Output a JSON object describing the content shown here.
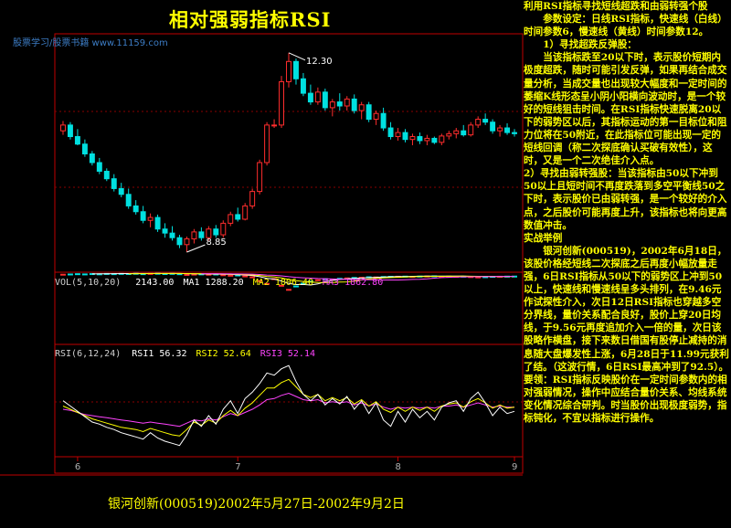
{
  "title": "相对强弱指标RSI",
  "watermark": "股票学习/股票书籍 www.11159.com",
  "caption": "银河创新(000519)2002年5月27日-2002年9月2日",
  "colors": {
    "up": "#ff2d2d",
    "down": "#00e0e0",
    "text": "#ffff00",
    "border": "#c00000",
    "ma1": "#ffffff",
    "ma2": "#ffff00",
    "ma3": "#ff44ff"
  },
  "volume_indicator": {
    "label": "VOL(5,10,20)",
    "value": "2143.00",
    "ma1": "MA1 1288.20",
    "ma2": "MA2 1806.40",
    "ma3": "MA3 1862.80"
  },
  "rsi_indicator": {
    "label": "RSI(6,12,24)",
    "rsi1": "RSI1 56.32",
    "rsi2": "RSI2 52.64",
    "rsi3": "RSI3 52.14"
  },
  "chart_data": {
    "type": "candlestick",
    "annotations": {
      "high": "12.30",
      "low": "8.85"
    },
    "x_ticks": [
      "6",
      "7",
      "8",
      "9"
    ],
    "ohlc": [
      [
        10.95,
        11.12,
        10.88,
        11.05
      ],
      [
        11.05,
        11.1,
        10.8,
        10.85
      ],
      [
        10.85,
        10.98,
        10.7,
        10.72
      ],
      [
        10.72,
        10.8,
        10.5,
        10.55
      ],
      [
        10.55,
        10.6,
        10.35,
        10.4
      ],
      [
        10.4,
        10.48,
        10.2,
        10.25
      ],
      [
        10.25,
        10.3,
        10.08,
        10.12
      ],
      [
        10.12,
        10.2,
        9.9,
        9.95
      ],
      [
        9.95,
        10.05,
        9.8,
        9.85
      ],
      [
        9.85,
        9.95,
        9.6,
        9.65
      ],
      [
        9.65,
        9.75,
        9.5,
        9.55
      ],
      [
        9.55,
        9.65,
        9.35,
        9.4
      ],
      [
        9.4,
        9.52,
        9.28,
        9.45
      ],
      [
        9.45,
        9.5,
        9.2,
        9.25
      ],
      [
        9.25,
        9.35,
        9.1,
        9.18
      ],
      [
        9.18,
        9.3,
        9.05,
        9.1
      ],
      [
        9.1,
        9.15,
        8.92,
        8.98
      ],
      [
        8.98,
        9.12,
        8.85,
        9.08
      ],
      [
        9.08,
        9.25,
        9.0,
        9.2
      ],
      [
        9.2,
        9.28,
        9.05,
        9.1
      ],
      [
        9.1,
        9.3,
        9.05,
        9.25
      ],
      [
        9.25,
        9.32,
        9.1,
        9.15
      ],
      [
        9.15,
        9.4,
        9.1,
        9.35
      ],
      [
        9.35,
        9.55,
        9.3,
        9.5
      ],
      [
        9.5,
        9.62,
        9.38,
        9.42
      ],
      [
        9.42,
        9.7,
        9.4,
        9.65
      ],
      [
        9.65,
        9.95,
        9.6,
        9.9
      ],
      [
        9.9,
        10.45,
        9.85,
        10.4
      ],
      [
        10.4,
        11.1,
        10.35,
        11.05
      ],
      [
        11.05,
        11.15,
        11.0,
        11.05
      ],
      [
        11.05,
        11.9,
        11.0,
        11.8
      ],
      [
        11.8,
        12.3,
        11.7,
        12.15
      ],
      [
        12.15,
        12.2,
        11.75,
        11.85
      ],
      [
        11.85,
        11.95,
        11.55,
        11.6
      ],
      [
        11.6,
        11.75,
        11.4,
        11.45
      ],
      [
        11.45,
        11.7,
        11.4,
        11.62
      ],
      [
        11.62,
        11.68,
        11.3,
        11.35
      ],
      [
        11.35,
        11.5,
        11.2,
        11.45
      ],
      [
        11.45,
        11.6,
        11.3,
        11.38
      ],
      [
        11.38,
        11.55,
        11.3,
        11.5
      ],
      [
        11.5,
        11.58,
        11.25,
        11.3
      ],
      [
        11.3,
        11.45,
        11.15,
        11.4
      ],
      [
        11.4,
        11.45,
        11.1,
        11.15
      ],
      [
        11.15,
        11.3,
        11.05,
        11.25
      ],
      [
        11.25,
        11.35,
        10.95,
        11.0
      ],
      [
        11.0,
        11.1,
        10.8,
        10.85
      ],
      [
        10.85,
        11.0,
        10.78,
        10.92
      ],
      [
        10.92,
        10.98,
        10.75,
        10.8
      ],
      [
        10.8,
        10.9,
        10.7,
        10.85
      ],
      [
        10.85,
        10.92,
        10.72,
        10.78
      ],
      [
        10.78,
        10.88,
        10.7,
        10.82
      ],
      [
        10.82,
        10.85,
        10.72,
        10.75
      ],
      [
        10.75,
        10.9,
        10.7,
        10.86
      ],
      [
        10.86,
        10.95,
        10.8,
        10.9
      ],
      [
        10.9,
        11.0,
        10.82,
        10.95
      ],
      [
        10.95,
        11.05,
        10.85,
        10.88
      ],
      [
        10.88,
        11.1,
        10.85,
        11.05
      ],
      [
        11.05,
        11.2,
        11.0,
        11.15
      ],
      [
        11.15,
        11.25,
        11.05,
        11.1
      ],
      [
        11.1,
        11.15,
        10.9,
        10.95
      ],
      [
        10.95,
        11.05,
        10.85,
        11.0
      ],
      [
        11.0,
        11.08,
        10.88,
        10.92
      ],
      [
        10.92,
        10.98,
        10.85,
        10.9
      ]
    ],
    "volume": [
      520,
      480,
      430,
      470,
      410,
      450,
      390,
      420,
      380,
      400,
      360,
      420,
      380,
      350,
      400,
      370,
      430,
      560,
      500,
      460,
      520,
      480,
      610,
      700,
      650,
      820,
      980,
      1650,
      2150,
      1300,
      2480,
      3200,
      2600,
      2100,
      1750,
      1500,
      1300,
      1400,
      1250,
      1180,
      1100,
      1050,
      980,
      1000,
      940,
      900,
      880,
      860,
      900,
      850,
      830,
      810,
      880,
      860,
      900,
      870,
      940,
      1000,
      960,
      900,
      880,
      860,
      850
    ],
    "rsi": {
      "rsi1": [
        60,
        55,
        50,
        45,
        40,
        38,
        35,
        33,
        30,
        28,
        26,
        24,
        30,
        25,
        22,
        20,
        18,
        28,
        42,
        36,
        46,
        38,
        52,
        60,
        48,
        62,
        68,
        76,
        86,
        84,
        90,
        93,
        78,
        66,
        60,
        66,
        56,
        62,
        57,
        64,
        52,
        60,
        48,
        58,
        42,
        36,
        50,
        40,
        52,
        44,
        50,
        42,
        54,
        58,
        60,
        50,
        62,
        68,
        58,
        46,
        54,
        48,
        50
      ],
      "rsi2": [
        55,
        52,
        49,
        46,
        43,
        41,
        39,
        37,
        35,
        34,
        33,
        31,
        34,
        32,
        30,
        28,
        27,
        33,
        40,
        37,
        42,
        39,
        46,
        51,
        46,
        53,
        58,
        65,
        72,
        72,
        77,
        80,
        73,
        66,
        63,
        66,
        60,
        63,
        60,
        63,
        57,
        61,
        55,
        59,
        52,
        49,
        54,
        50,
        54,
        51,
        54,
        50,
        55,
        57,
        58,
        54,
        59,
        62,
        58,
        53,
        56,
        53,
        54
      ],
      "rsi3": [
        52,
        51,
        49,
        47,
        46,
        45,
        44,
        43,
        42,
        41,
        40,
        39,
        40,
        39,
        38,
        37,
        36,
        39,
        42,
        41,
        43,
        42,
        45,
        48,
        46,
        49,
        52,
        56,
        61,
        62,
        65,
        67,
        64,
        61,
        60,
        61,
        58,
        59,
        58,
        59,
        56,
        58,
        55,
        57,
        54,
        52,
        54,
        53,
        54,
        53,
        54,
        53,
        55,
        55,
        56,
        54,
        56,
        58,
        56,
        54,
        55,
        54,
        54
      ]
    }
  },
  "side_text": [
    {
      "t": "利用RSI指标寻找短线超跌和由弱转强个股",
      "indent": false
    },
    {
      "t": "参数设定：日线RSI指标，快速线（白线）时间参数6，慢速线（黄线）时间参数12。",
      "indent": true
    },
    {
      "t": "1）寻找超跌反弹股：",
      "indent": true
    },
    {
      "t": "当该指标跌至20以下时，表示股价短期内极度超跌，随时可能引发反弹，如果再结合成交量分析，当成交量也出现较大幅度和一定时间的萎缩K线形态呈小阴小阳横向波动时，是一个较好的短线狙击时间。在RSI指标快速脱离20以下的弱势区以后，其指标运动的第一目标位和阻力位将在50附近，在此指标位可能出现一定的短线回调（称二次探底确认买破有效性），这时，又是一个二次绝佳介入点。",
      "indent": true
    },
    {
      "t": "2）寻找由弱转强股：当该指标由50以下冲到50以上且短时间不再度跌落到多空平衡线50之下时，表示股价已由弱转强，是一个较好的介入点，之后股价可能再度上升，该指标也将向更高数值冲击。",
      "indent": false
    },
    {
      "t": "实战举例",
      "indent": false
    },
    {
      "t": "银河创新(000519)，2002年6月18日，该股价格经短线二次探底之后再度小幅放量走强，6日RSI指标从50以下的弱势区上冲到50以上，快速线和慢速线呈多头排列，在9.46元作试探性介入，次日12日RSI指标也穿越多空分界线，量价关系配合良好，股价上穿20日均线，于9.56元再度追加介入一倍的量，次日该股略作横盘，接下来数日借国有股停止减持的消息随大盘爆发性上涨，6月28日于11.99元获利了结。（这波行情，6日RSI最高冲到了92.5）。",
      "indent": true
    },
    {
      "t": "要领：RSI指标反映股价在一定时间参数内的相对强弱情况，操作中应结合量价关系、均线系统变化情况综合研判。时当股价出现极度弱势，指标钝化，不宜以指标进行操作。",
      "indent": false
    }
  ]
}
